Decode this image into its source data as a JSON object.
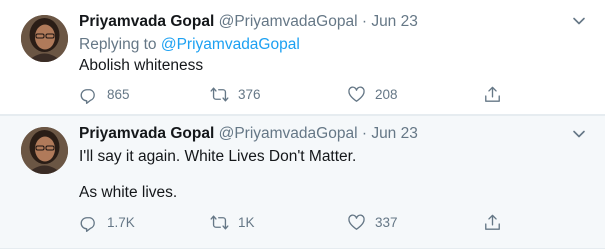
{
  "tweets": [
    {
      "name": "Priyamvada Gopal",
      "handle": "@PriyamvadaGopal",
      "separator": "·",
      "date": "Jun 23",
      "replying_prefix": "Replying to",
      "replying_to": "@PriyamvadaGopal",
      "lines": [
        "Abolish whiteness"
      ],
      "replies": "865",
      "retweets": "376",
      "likes": "208"
    },
    {
      "name": "Priyamvada Gopal",
      "handle": "@PriyamvadaGopal",
      "separator": "·",
      "date": "Jun 23",
      "lines": [
        "I'll say it again. White Lives Don't Matter.",
        "As white lives."
      ],
      "replies": "1.7K",
      "retweets": "1K",
      "likes": "337"
    }
  ],
  "icons": {
    "reply": "reply-icon",
    "retweet": "retweet-icon",
    "like": "heart-icon",
    "share": "share-icon",
    "menu": "chevron-down-icon"
  },
  "colors": {
    "text": "#14171a",
    "muted": "#657786",
    "link": "#1da1f2",
    "highlight_bg": "#f5f8fa"
  }
}
